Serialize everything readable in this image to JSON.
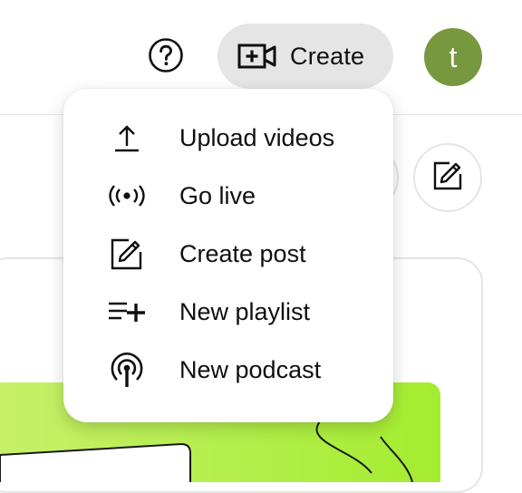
{
  "header": {
    "help_icon": "help-circle-icon",
    "create_label": "Create",
    "create_icon": "video-add-icon",
    "avatar_letter": "t",
    "avatar_color": "#77983f"
  },
  "create_menu": {
    "items": [
      {
        "label": "Upload videos",
        "icon": "upload-icon"
      },
      {
        "label": "Go live",
        "icon": "live-broadcast-icon"
      },
      {
        "label": "Create post",
        "icon": "edit-post-icon"
      },
      {
        "label": "New playlist",
        "icon": "playlist-add-icon"
      },
      {
        "label": "New podcast",
        "icon": "podcast-icon"
      }
    ]
  },
  "colors": {
    "create_button_bg": "#e5e5e5",
    "banner": "#b3ef4a"
  }
}
